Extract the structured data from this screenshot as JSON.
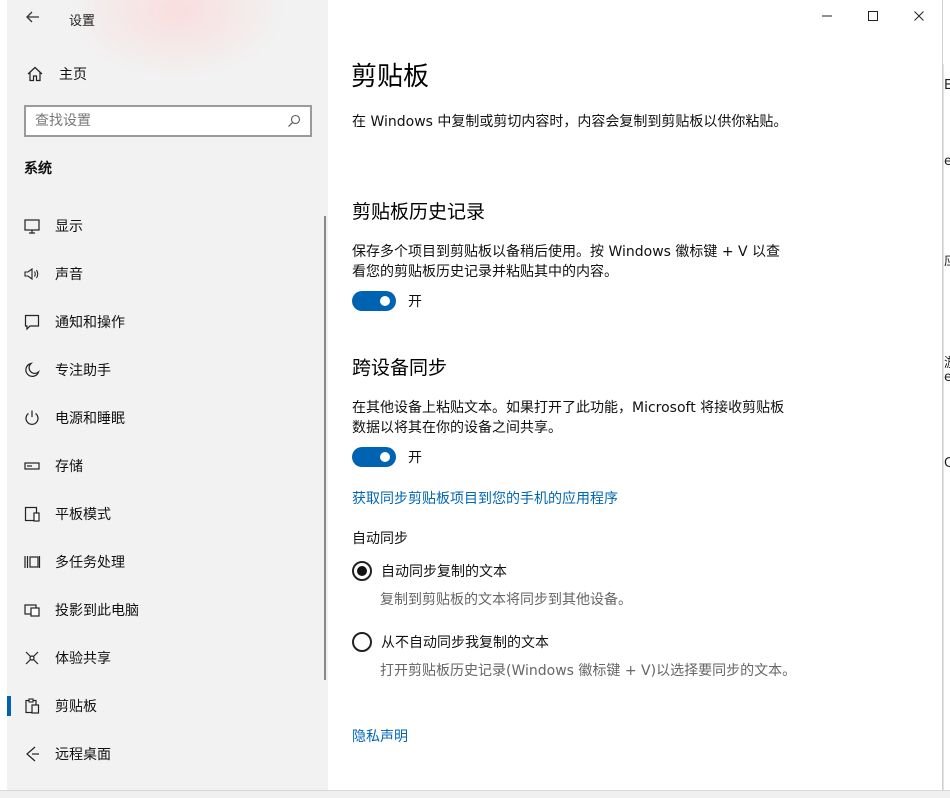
{
  "app": {
    "title": "设置",
    "controls": {
      "minimize": "—",
      "maximize": "☐",
      "close": "✕"
    }
  },
  "sidebar": {
    "home_label": "主页",
    "search_placeholder": "查找设置",
    "section_title": "系统",
    "items": [
      {
        "label": "显示",
        "icon": "monitor-icon"
      },
      {
        "label": "声音",
        "icon": "speaker-icon"
      },
      {
        "label": "通知和操作",
        "icon": "notification-icon"
      },
      {
        "label": "专注助手",
        "icon": "moon-icon"
      },
      {
        "label": "电源和睡眠",
        "icon": "power-icon"
      },
      {
        "label": "存储",
        "icon": "storage-icon"
      },
      {
        "label": "平板模式",
        "icon": "tablet-icon"
      },
      {
        "label": "多任务处理",
        "icon": "multitask-icon"
      },
      {
        "label": "投影到此电脑",
        "icon": "project-icon"
      },
      {
        "label": "体验共享",
        "icon": "share-icon"
      },
      {
        "label": "剪贴板",
        "icon": "clipboard-icon",
        "active": true
      },
      {
        "label": "远程桌面",
        "icon": "remote-desktop-icon"
      }
    ]
  },
  "main": {
    "title": "剪贴板",
    "intro": "在 Windows 中复制或剪切内容时，内容会复制到剪贴板以供你粘贴。",
    "history": {
      "heading": "剪贴板历史记录",
      "desc": "保存多个项目到剪贴板以备稍后使用。按 Windows 徽标键 + V 以查看您的剪贴板历史记录并粘贴其中的内容。",
      "toggle_label": "开"
    },
    "sync": {
      "heading": "跨设备同步",
      "desc": "在其他设备上粘贴文本。如果打开了此功能，Microsoft 将接收剪贴板数据以将其在你的设备之间共享。",
      "toggle_label": "开",
      "link": "获取同步剪贴板项目到您的手机的应用程序",
      "auto_sync_label": "自动同步",
      "options": [
        {
          "label": "自动同步复制的文本",
          "desc": "复制到剪贴板的文本将同步到其他设备。",
          "checked": true
        },
        {
          "label": "从不自动同步我复制的文本",
          "desc": "打开剪贴板历史记录(Windows 徽标键 + V)以选择要同步的文本。",
          "checked": false
        }
      ]
    },
    "privacy_link": "隐私声明"
  },
  "background": {
    "fragments": [
      "E",
      "e",
      "应",
      "游",
      "e",
      "Cc"
    ]
  },
  "colors": {
    "accent": "#0063b1",
    "link": "#0066b4",
    "sidebar_bg": "#f2f2f2"
  }
}
